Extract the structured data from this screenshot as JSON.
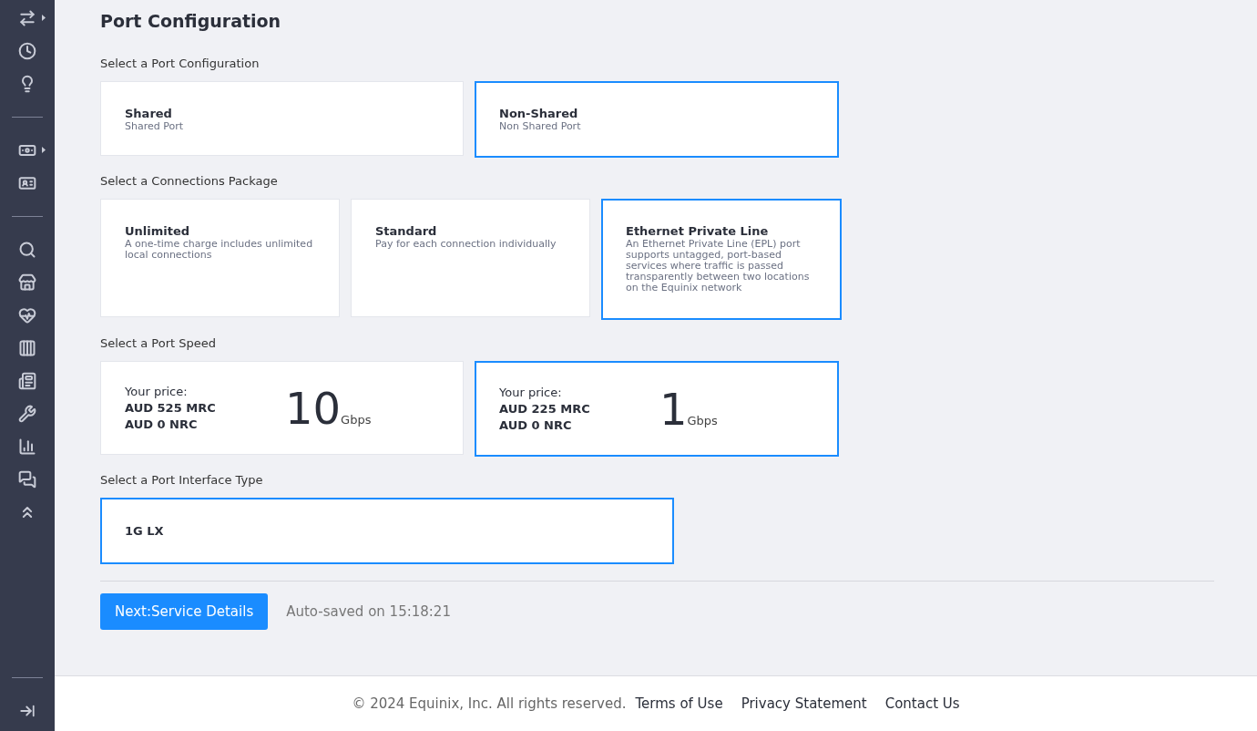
{
  "title": "Port Configuration",
  "sections": [
    {
      "label": "Select a Port Configuration",
      "kind": "option",
      "cards": [
        {
          "title": "Shared",
          "description": "Shared Port",
          "selected": false
        },
        {
          "title": "Non-Shared",
          "description": "Non Shared Port",
          "selected": true
        }
      ]
    },
    {
      "label": "Select a Connections Package",
      "kind": "package",
      "cards": [
        {
          "title": "Unlimited",
          "description": "A one-time charge includes unlimited local connections",
          "selected": false
        },
        {
          "title": "Standard",
          "description": "Pay for each connection individually",
          "selected": false
        },
        {
          "title": "Ethernet Private Line",
          "description": "An Ethernet Private Line (EPL) port supports untagged, port-based services where traffic is passed transparently between two locations on the Equinix network",
          "selected": true
        }
      ]
    },
    {
      "label": "Select a Port Speed",
      "kind": "speed",
      "cards": [
        {
          "price_label": "Your price:",
          "mrc": "AUD 525 MRC",
          "nrc": "AUD 0 NRC",
          "speed": "10",
          "unit": "Gbps",
          "selected": false
        },
        {
          "price_label": "Your price:",
          "mrc": "AUD 225 MRC",
          "nrc": "AUD 0 NRC",
          "speed": "1",
          "unit": "Gbps",
          "selected": true
        }
      ]
    },
    {
      "label": "Select a Port Interface Type",
      "kind": "interface",
      "cards": [
        {
          "title": "1G LX",
          "selected": true
        }
      ]
    }
  ],
  "next_button": "Next:Service Details",
  "autosave": "Auto-saved on 15:18:21",
  "footer": {
    "copyright": "© 2024 Equinix, Inc. All rights reserved.",
    "links": [
      "Terms of Use",
      "Privacy Statement",
      "Contact Us"
    ]
  }
}
